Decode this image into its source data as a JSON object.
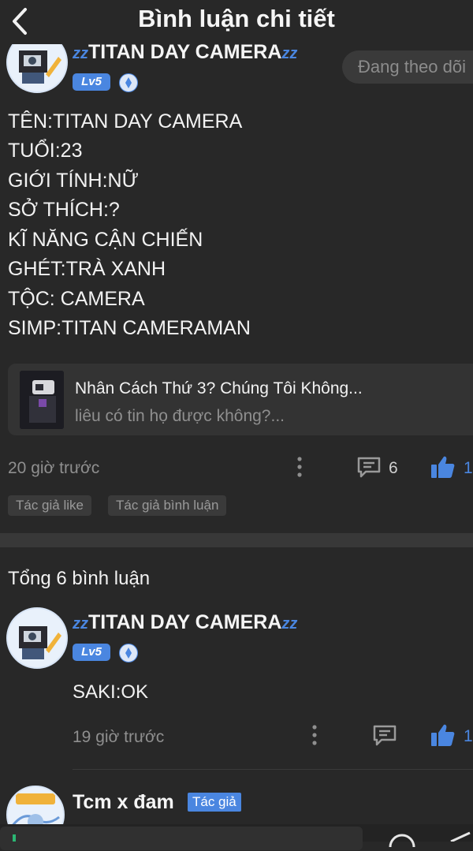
{
  "header": {
    "title": "Bình luận chi tiết"
  },
  "post": {
    "author": {
      "name": "TITAN DAY CAMERA",
      "level": "Lv5",
      "zz": "zz"
    },
    "follow_label": "Đang theo dõi",
    "lines": [
      "TÊN:TITAN DAY CAMERA",
      "TUỔI:23",
      "GIỚI TÍNH:NỮ",
      "SỞ THÍCH:?",
      "KĨ NĂNG CẬN CHIẾN",
      "GHÉT:TRÀ XANH",
      "TỘC: CAMERA",
      "SIMP:TITAN CAMERAMAN"
    ],
    "link_card": {
      "title": "Nhân Cách Thứ 3? Chúng Tôi Không...",
      "subtitle": "liêu có tin họ được không?..."
    },
    "time": "20 giờ trước",
    "comment_count": "6",
    "like_count": "1",
    "tags": [
      "Tác giả like",
      "Tác giả bình luận"
    ]
  },
  "comments_section": {
    "total_label": "Tổng 6 bình luận",
    "comments": [
      {
        "author": "TITAN DAY CAMERA",
        "level": "Lv5",
        "text": "SAKI:OK",
        "time": "19 giờ trước",
        "like_count": "1"
      },
      {
        "author": "Tcm x đam",
        "author_tag": "Tác giả"
      }
    ]
  },
  "colors": {
    "background": "#282828",
    "accent": "#4a86e0",
    "muted": "#8f8f8f"
  }
}
